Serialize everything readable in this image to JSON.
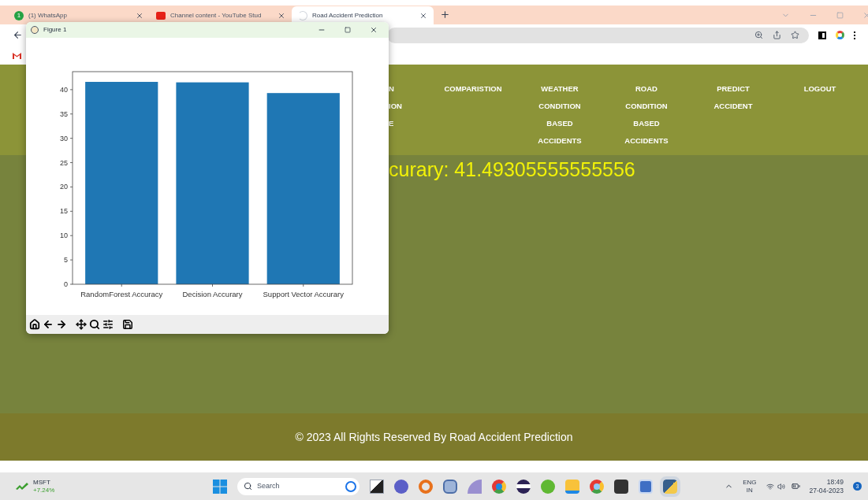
{
  "browser": {
    "tabs": [
      {
        "title": "(1) WhatsApp",
        "badge": "1",
        "selected": false
      },
      {
        "title": "Channel content - YouTube Stud",
        "selected": false
      },
      {
        "title": "Road Accident Prediction",
        "selected": true
      }
    ]
  },
  "site": {
    "nav": [
      {
        "lines": [
          "N",
          "ION",
          "E"
        ]
      },
      {
        "lines": [
          "COMPARISTION"
        ]
      },
      {
        "lines": [
          "WEATHER",
          "CONDITION",
          "BASED",
          "ACCIDENTS"
        ]
      },
      {
        "lines": [
          "ROAD",
          "CONDITION",
          "BASED",
          "ACCIDENTS"
        ]
      },
      {
        "lines": [
          "PREDICT",
          "ACCIDENT"
        ]
      },
      {
        "lines": [
          "LOGOUT"
        ]
      }
    ],
    "result_text": "curary: 41.49305555555556",
    "footer": "© 2023 All Rights Reserved By Road Accident Prediction"
  },
  "figure_window": {
    "title": "Figure 1",
    "chart_data": {
      "type": "bar",
      "categories": [
        "RandomForest Accuracy",
        "Decision Accurary",
        "Support Vector Accurary"
      ],
      "color": "#1f77b4",
      "values": [
        41.6,
        41.5,
        39.3
      ],
      "ylim": [
        0,
        43.7
      ],
      "yticks": [
        0,
        5,
        10,
        15,
        20,
        25,
        30,
        35,
        40
      ]
    }
  },
  "taskbar": {
    "stock": {
      "symbol": "MSFT",
      "change": "+7.24%"
    },
    "search": {
      "placeholder": "Search"
    },
    "language": {
      "code": "ENG",
      "region": "IN"
    },
    "time": "18:49",
    "date": "27-04-2023",
    "notification_count": "3"
  }
}
